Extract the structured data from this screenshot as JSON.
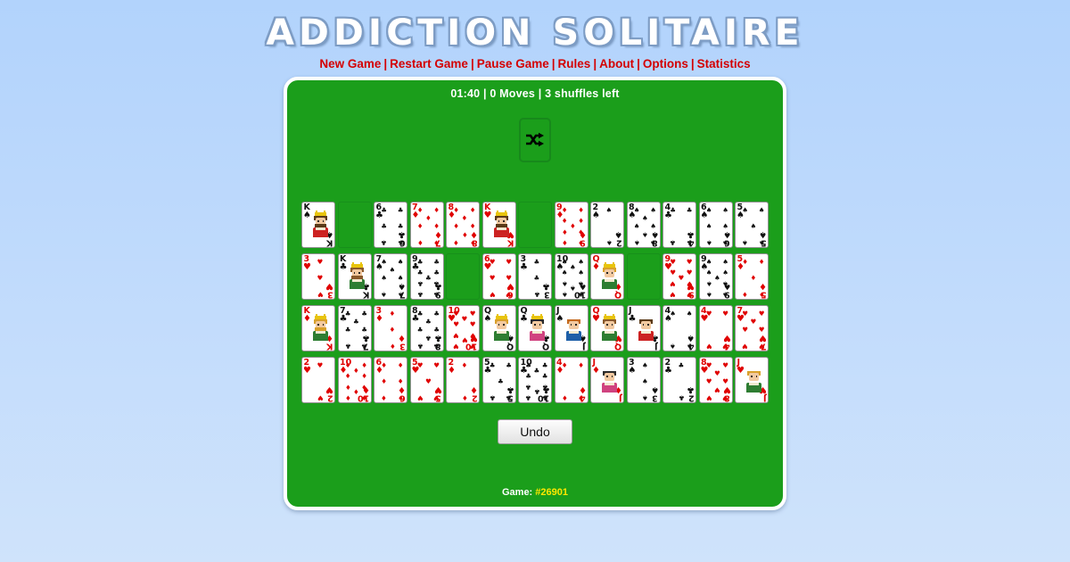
{
  "header": {
    "title": "ADDICTION SOLITAIRE",
    "menu": [
      {
        "label": "New Game",
        "name": "menu-new-game"
      },
      {
        "label": "Restart Game",
        "name": "menu-restart-game"
      },
      {
        "label": "Pause Game",
        "name": "menu-pause-game"
      },
      {
        "label": "Rules",
        "name": "menu-rules"
      },
      {
        "label": "About",
        "name": "menu-about"
      },
      {
        "label": "Options",
        "name": "menu-options"
      },
      {
        "label": "Statistics",
        "name": "menu-statistics"
      }
    ],
    "separator": "|"
  },
  "status": {
    "time": "01:40",
    "moves": "0 Moves",
    "shuffles": "3 shuffles left",
    "text": "01:40 | 0 Moves | 3 shuffles left"
  },
  "shuffle": {
    "icon": "shuffle-icon",
    "label": "Shuffle"
  },
  "undo": {
    "label": "Undo"
  },
  "game_number": {
    "label": "Game:",
    "value": "#26901"
  },
  "colors": {
    "board_green": "#1b9e1b",
    "title_white": "#ffffff",
    "menu_red": "#d40000",
    "game_number_yellow": "#ffe800",
    "card_red": "#e00000",
    "card_black": "#101010",
    "page_bg_top": "#b2d3fc",
    "page_bg_bottom": "#cfe3fb"
  },
  "board": {
    "columns": 13,
    "rows": 4,
    "cards": [
      [
        {
          "rank": "K",
          "suit": "spades"
        },
        {
          "empty": true
        },
        {
          "rank": "6",
          "suit": "clubs"
        },
        {
          "rank": "7",
          "suit": "diamonds"
        },
        {
          "rank": "8",
          "suit": "diamonds"
        },
        {
          "rank": "K",
          "suit": "hearts"
        },
        {
          "empty": true
        },
        {
          "rank": "9",
          "suit": "diamonds"
        },
        {
          "rank": "2",
          "suit": "spades"
        },
        {
          "rank": "8",
          "suit": "spades"
        },
        {
          "rank": "4",
          "suit": "clubs"
        },
        {
          "rank": "6",
          "suit": "spades"
        },
        {
          "rank": "5",
          "suit": "spades"
        }
      ],
      [
        {
          "rank": "3",
          "suit": "hearts"
        },
        {
          "rank": "K",
          "suit": "clubs"
        },
        {
          "rank": "7",
          "suit": "spades"
        },
        {
          "rank": "9",
          "suit": "clubs"
        },
        {
          "empty": true
        },
        {
          "rank": "6",
          "suit": "hearts"
        },
        {
          "rank": "3",
          "suit": "clubs"
        },
        {
          "rank": "10",
          "suit": "spades"
        },
        {
          "rank": "Q",
          "suit": "diamonds"
        },
        {
          "empty": true
        },
        {
          "rank": "9",
          "suit": "hearts"
        },
        {
          "rank": "9",
          "suit": "spades"
        },
        {
          "rank": "5",
          "suit": "diamonds"
        }
      ],
      [
        {
          "rank": "K",
          "suit": "diamonds"
        },
        {
          "rank": "7",
          "suit": "clubs"
        },
        {
          "rank": "3",
          "suit": "diamonds"
        },
        {
          "rank": "8",
          "suit": "clubs"
        },
        {
          "rank": "10",
          "suit": "hearts"
        },
        {
          "rank": "Q",
          "suit": "spades"
        },
        {
          "rank": "Q",
          "suit": "clubs"
        },
        {
          "rank": "J",
          "suit": "spades"
        },
        {
          "rank": "Q",
          "suit": "hearts"
        },
        {
          "rank": "J",
          "suit": "clubs"
        },
        {
          "rank": "4",
          "suit": "spades"
        },
        {
          "rank": "4",
          "suit": "hearts"
        },
        {
          "rank": "7",
          "suit": "hearts"
        }
      ],
      [
        {
          "rank": "2",
          "suit": "hearts"
        },
        {
          "rank": "10",
          "suit": "diamonds"
        },
        {
          "rank": "6",
          "suit": "diamonds"
        },
        {
          "rank": "5",
          "suit": "hearts"
        },
        {
          "rank": "2",
          "suit": "diamonds"
        },
        {
          "rank": "5",
          "suit": "clubs"
        },
        {
          "rank": "10",
          "suit": "clubs"
        },
        {
          "rank": "4",
          "suit": "diamonds"
        },
        {
          "rank": "J",
          "suit": "diamonds"
        },
        {
          "rank": "3",
          "suit": "spades"
        },
        {
          "rank": "2",
          "suit": "clubs"
        },
        {
          "rank": "8",
          "suit": "hearts"
        },
        {
          "rank": "J",
          "suit": "hearts"
        }
      ]
    ]
  }
}
